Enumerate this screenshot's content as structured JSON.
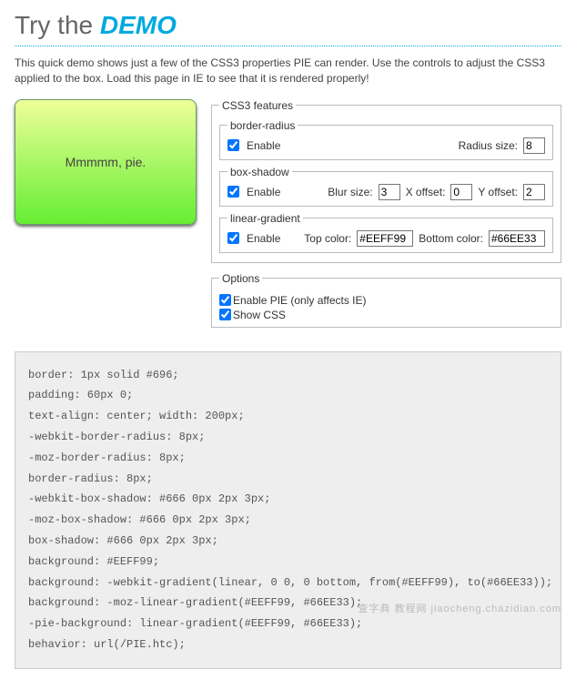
{
  "header": {
    "prefix": "Try the ",
    "demo_word": "DEMO"
  },
  "intro": "This quick demo shows just a few of the CSS3 properties PIE can render. Use the controls to adjust the CSS3 applied to the box. Load this page in IE to see that it is rendered properly!",
  "pie_box_text": "Mmmmm, pie.",
  "features": {
    "legend": "CSS3 features",
    "border_radius": {
      "legend": "border-radius",
      "enable_label": "Enable",
      "enable_checked": true,
      "radius_label": "Radius size:",
      "radius_value": "8"
    },
    "box_shadow": {
      "legend": "box-shadow",
      "enable_label": "Enable",
      "enable_checked": true,
      "blur_label": "Blur size:",
      "blur_value": "3",
      "xoff_label": "X offset:",
      "xoff_value": "0",
      "yoff_label": "Y offset:",
      "yoff_value": "2"
    },
    "linear_gradient": {
      "legend": "linear-gradient",
      "enable_label": "Enable",
      "enable_checked": true,
      "top_label": "Top color:",
      "top_value": "#EEFF99",
      "bottom_label": "Bottom color:",
      "bottom_value": "#66EE33"
    }
  },
  "options": {
    "legend": "Options",
    "enable_pie_label": "Enable PIE (only affects IE)",
    "enable_pie_checked": true,
    "show_css_label": "Show CSS",
    "show_css_checked": true
  },
  "css_output": "border: 1px solid #696;\npadding: 60px 0;\ntext-align: center; width: 200px;\n-webkit-border-radius: 8px;\n-moz-border-radius: 8px;\nborder-radius: 8px;\n-webkit-box-shadow: #666 0px 2px 3px;\n-moz-box-shadow: #666 0px 2px 3px;\nbox-shadow: #666 0px 2px 3px;\nbackground: #EEFF99;\nbackground: -webkit-gradient(linear, 0 0, 0 bottom, from(#EEFF99), to(#66EE33));\nbackground: -moz-linear-gradient(#EEFF99, #66EE33);\n-pie-background: linear-gradient(#EEFF99, #66EE33);\nbehavior: url(/PIE.htc);",
  "watermark": "查字典 教程网\njiaocheng.chazidian.com"
}
